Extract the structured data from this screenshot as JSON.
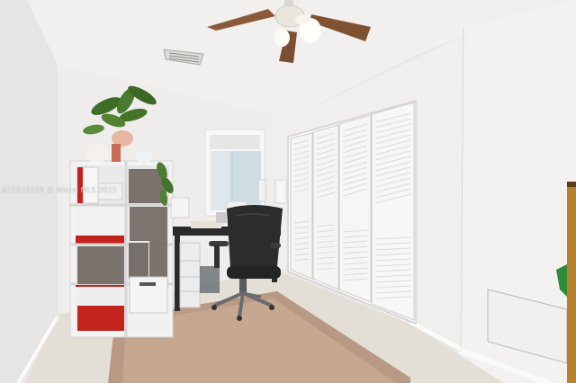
{
  "photo": {
    "watermark": "A11816216 © Miami MLS 2025"
  },
  "colors": {
    "wall": "#ecebe9",
    "ceiling": "#f2f1ef",
    "floor": "#e3ddd2",
    "rug": "#c9ab95",
    "rug_border": "#b89a84",
    "closet_door": "#f5f5f4",
    "shelf_white": "#f4f4f4",
    "shelf_red": "#c2241d",
    "storage_bin": "#7a726b",
    "chair": "#2b2c2e",
    "fan_blade": "#8a5a38",
    "plant": "#3d6b26",
    "wood_trim": "#b7812e"
  },
  "icons": {
    "ceiling_fan": "ceiling-fan-icon",
    "air_vent": "air-vent-icon"
  }
}
